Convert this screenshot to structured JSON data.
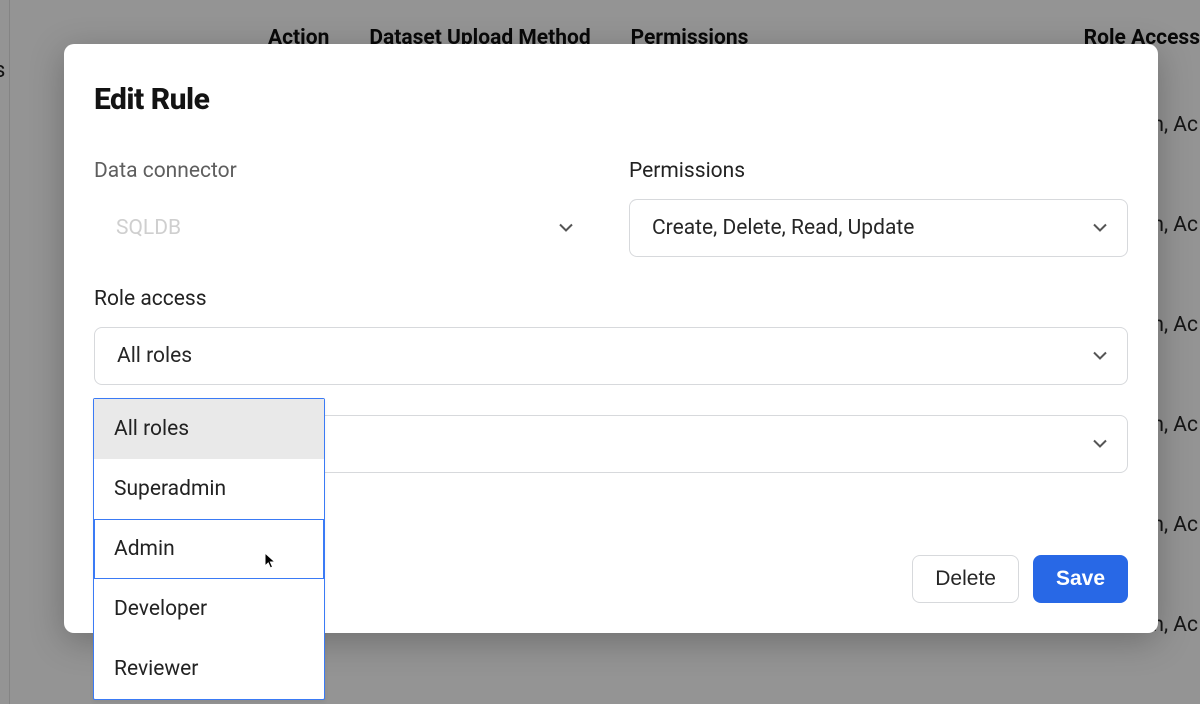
{
  "background": {
    "sidebar_fragment": "s",
    "headers": {
      "action": "Action",
      "dataset_upload_method": "Dataset Upload Method",
      "permissions": "Permissions",
      "role_access": "Role Access"
    },
    "row_fragment": "n, Ac"
  },
  "modal": {
    "title": "Edit Rule",
    "fields": {
      "data_connector": {
        "label": "Data connector",
        "placeholder": "SQLDB"
      },
      "permissions": {
        "label": "Permissions",
        "value": "Create, Delete, Read, Update"
      },
      "role_access": {
        "label": "Role access",
        "value": "All roles",
        "options": [
          "All roles",
          "Superadmin",
          "Admin",
          "Developer",
          "Reviewer"
        ],
        "selected_index": 0,
        "hovered_index": 2
      },
      "extra_select": {
        "value": ""
      }
    },
    "buttons": {
      "delete": "Delete",
      "save": "Save"
    }
  }
}
